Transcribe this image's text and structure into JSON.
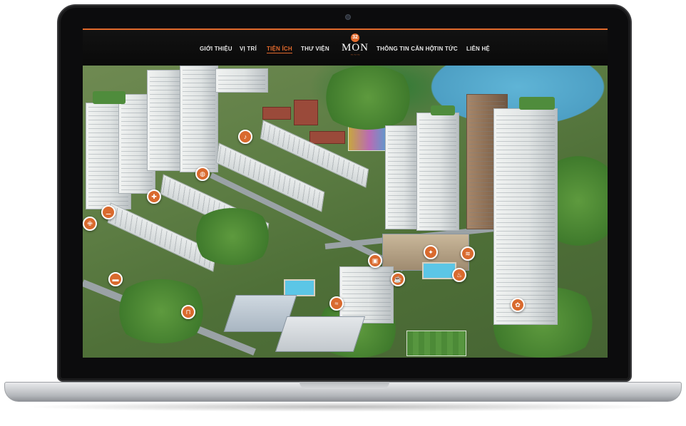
{
  "nav": {
    "items": [
      {
        "label": "GIỚI THIỆU",
        "active": false
      },
      {
        "label": "VỊ TRÍ",
        "active": false
      },
      {
        "label": "TIỆN ÍCH",
        "active": true
      },
      {
        "label": "THƯ VIỆN",
        "active": false
      },
      {
        "label": "THÔNG TIN CĂN HỘ",
        "active": false
      },
      {
        "label": "TIN TỨC",
        "active": false
      },
      {
        "label": "LIÊN HỆ",
        "active": false
      }
    ],
    "accent_color": "#e26a2c"
  },
  "logo": {
    "text": "MON",
    "mark": "32"
  },
  "markers": [
    {
      "icon": "music-icon",
      "glyph": "♪"
    },
    {
      "icon": "tennis-icon",
      "glyph": "◍"
    },
    {
      "icon": "gym-icon",
      "glyph": "✚"
    },
    {
      "icon": "dumbbell-icon",
      "glyph": "⚊"
    },
    {
      "icon": "car-icon",
      "glyph": "▬"
    },
    {
      "icon": "bench-icon",
      "glyph": "⊓"
    },
    {
      "icon": "swim-icon",
      "glyph": "≈"
    },
    {
      "icon": "shop-icon",
      "glyph": "▣"
    },
    {
      "icon": "cafe-icon",
      "glyph": "☕"
    },
    {
      "icon": "restaurant-icon",
      "glyph": "✦"
    },
    {
      "icon": "pool-icon",
      "glyph": "≋"
    },
    {
      "icon": "bbq-icon",
      "glyph": "♨"
    },
    {
      "icon": "park-icon",
      "glyph": "✿"
    },
    {
      "icon": "clinic-icon",
      "glyph": "✙"
    }
  ]
}
